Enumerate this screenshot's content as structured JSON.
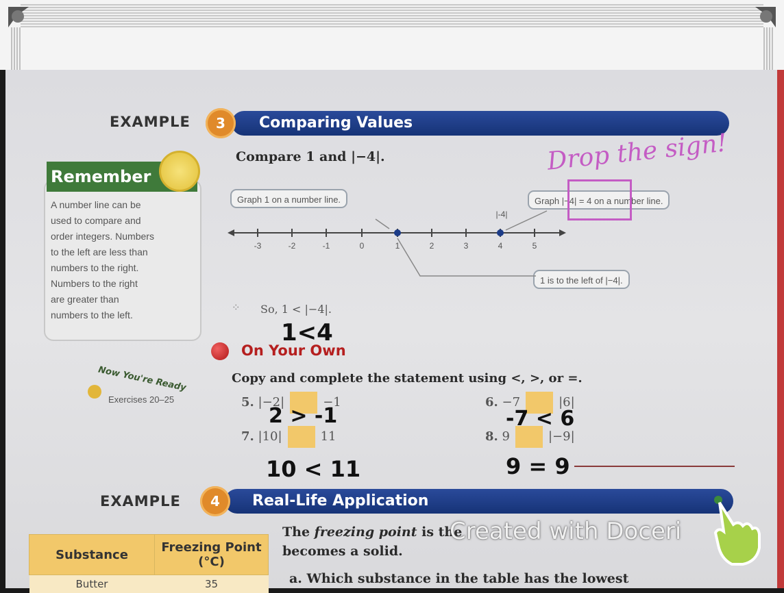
{
  "example3": {
    "label": "EXAMPLE",
    "number": "3",
    "title": "Comparing Values"
  },
  "prompt": "Compare 1 and |−4|.",
  "remember": {
    "title": "Remember",
    "lines": [
      "A number line can be",
      "used to compare and",
      "order integers. Numbers",
      "to the left are less than",
      "numbers to the right.",
      "Numbers to the right",
      "are greater than",
      "numbers to the left."
    ]
  },
  "callouts": {
    "graph1": "Graph 1 on a number line.",
    "graph4": "Graph |−4| = 4 on a number line.",
    "leftof": "1 is to the left of |−4|."
  },
  "number_line": {
    "ticks": [
      "-3",
      "-2",
      "-1",
      "0",
      "1",
      "2",
      "3",
      "4",
      "5"
    ],
    "point_label": "|-4|"
  },
  "conclusion": "So, 1 < |−4|.",
  "handwriting": {
    "drop_sign": "Drop the sign!",
    "answer_main": "1<4",
    "ans5": "2 > -1",
    "ans6": "-7 < 6",
    "ans7": "10 < 11",
    "ans8": "9 = 9"
  },
  "on_your_own": {
    "title": "On Your Own",
    "instruction": "Copy and complete the statement using <, >, or =.",
    "ready": "Now You're Ready",
    "exercises": "Exercises 20–25",
    "items": [
      {
        "n": "5.",
        "left": "|−2|",
        "right": "−1"
      },
      {
        "n": "6.",
        "left": "−7",
        "right": "|6|"
      },
      {
        "n": "7.",
        "left": "|10|",
        "right": "11"
      },
      {
        "n": "8.",
        "left": "9",
        "right": "|−9|"
      }
    ]
  },
  "example4": {
    "label": "EXAMPLE",
    "number": "4",
    "title": "Real-Life Application"
  },
  "freezing": {
    "sentence_a": "The ",
    "sentence_b": "freezing point",
    "sentence_c": " is the",
    "line2": "becomes a solid.",
    "question": "a.  Which substance in the table has the lowest"
  },
  "table": {
    "headers": [
      "Substance",
      "Freezing Point (°C)"
    ],
    "rows": [
      [
        "Butter",
        "35"
      ]
    ]
  },
  "watermark": "Created with Doceri",
  "colors": {
    "blue_bar": "#1c3c88",
    "orange": "#e08a2a",
    "green": "#3f7a3a",
    "pink": "#c45cc4",
    "table_yellow": "#f2c86a"
  }
}
